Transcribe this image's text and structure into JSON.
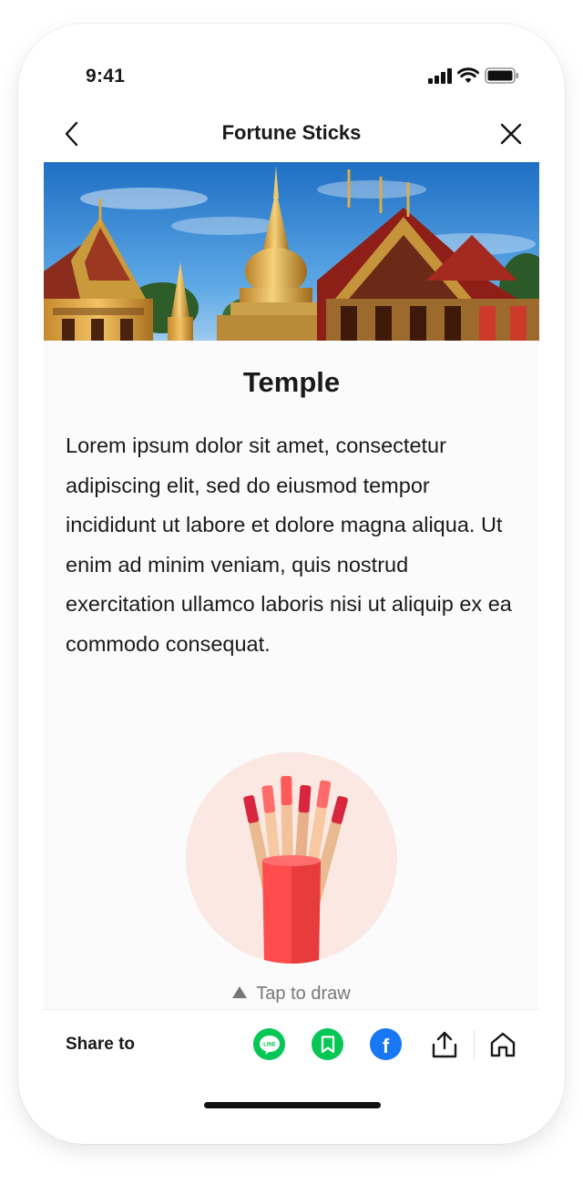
{
  "status_bar": {
    "time": "9:41"
  },
  "nav": {
    "title": "Fortune Sticks",
    "back_icon": "chevron-left-icon",
    "close_icon": "close-icon"
  },
  "hero": {
    "alt": "Temple"
  },
  "content": {
    "title": "Temple",
    "body": "Lorem ipsum dolor sit amet, consectetur adipiscing elit, sed do eiusmod tempor incididunt ut labore et dolore magna aliqua. Ut enim ad minim veniam, quis nostrud exercitation ullamco laboris nisi ut aliquip ex ea commodo consequat.",
    "tap_hint": "Tap to draw"
  },
  "share": {
    "label": "Share to",
    "icons": [
      {
        "name": "line-icon",
        "text": "LINE",
        "color": "#06c755"
      },
      {
        "name": "bookmark-icon",
        "color": "#06c755"
      },
      {
        "name": "facebook-icon",
        "text": "f",
        "color": "#1877f2"
      },
      {
        "name": "share-upload-icon",
        "color": "#1a1a1a"
      },
      {
        "name": "home-icon",
        "color": "#1a1a1a"
      }
    ]
  },
  "colors": {
    "cup": "#ff4d4d",
    "cup_shadow": "#e83c3c",
    "sticks_circle": "#fbe8e2",
    "stick_tip_dark": "#d7263d",
    "stick_tip_light": "#ff6b6b",
    "stick_body": "#f7c9a3"
  }
}
